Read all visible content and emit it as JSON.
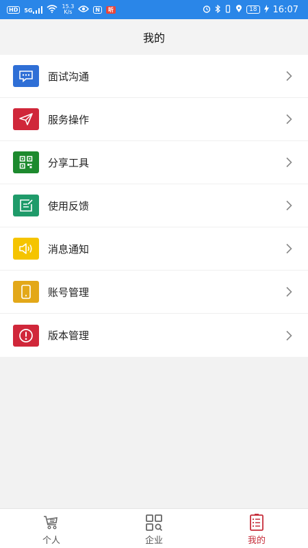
{
  "status_bar": {
    "network_badge": "HD",
    "signal_label": "5G",
    "speed_value": "15.3",
    "speed_unit": "K/s",
    "nfc_label": "N",
    "battery": "18",
    "time": "16:07"
  },
  "header": {
    "title": "我的"
  },
  "menu": {
    "items": [
      {
        "label": "面试沟通",
        "icon": "chat-icon",
        "color": "#2f6fd6"
      },
      {
        "label": "服务操作",
        "icon": "send-icon",
        "color": "#d0273a"
      },
      {
        "label": "分享工具",
        "icon": "qrcode-icon",
        "color": "#1d8a2e"
      },
      {
        "label": "使用反馈",
        "icon": "feedback-icon",
        "color": "#1f9b6a"
      },
      {
        "label": "消息通知",
        "icon": "speaker-icon",
        "color": "#f5c400"
      },
      {
        "label": "账号管理",
        "icon": "phone-icon",
        "color": "#e3a819"
      },
      {
        "label": "版本管理",
        "icon": "alert-icon",
        "color": "#d0273a"
      }
    ]
  },
  "tabbar": {
    "tabs": [
      {
        "label": "个人",
        "icon": "person-cart-icon",
        "active": false
      },
      {
        "label": "企业",
        "icon": "grid-search-icon",
        "active": false
      },
      {
        "label": "我的",
        "icon": "list-icon",
        "active": true
      }
    ]
  },
  "colors": {
    "status_bar_bg": "#2a86e8",
    "active_tab": "#c62d3a",
    "page_bg": "#f2f2f2"
  }
}
